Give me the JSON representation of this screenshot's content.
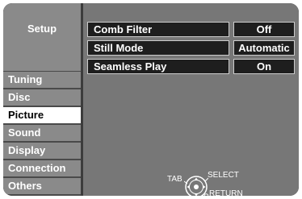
{
  "sidebar": {
    "title": "Setup",
    "items": [
      {
        "label": "Tuning",
        "active": false
      },
      {
        "label": "Disc",
        "active": false
      },
      {
        "label": "Picture",
        "active": true
      },
      {
        "label": "Sound",
        "active": false
      },
      {
        "label": "Display",
        "active": false
      },
      {
        "label": "Connection",
        "active": false
      },
      {
        "label": "Others",
        "active": false
      }
    ]
  },
  "settings": [
    {
      "label": "Comb Filter",
      "value": "Off"
    },
    {
      "label": "Still Mode",
      "value": "Automatic"
    },
    {
      "label": "Seamless Play",
      "value": "On"
    }
  ],
  "hints": {
    "tab": "TAB",
    "select": "SELECT",
    "return": "RETURN",
    "icon": "dpad-icon"
  },
  "colors": {
    "frame": "#3c3c3c",
    "panel": "#777777",
    "menu_item": "#8a8a8a",
    "active_item": "#ffffff",
    "field": "#1e1e1e"
  }
}
